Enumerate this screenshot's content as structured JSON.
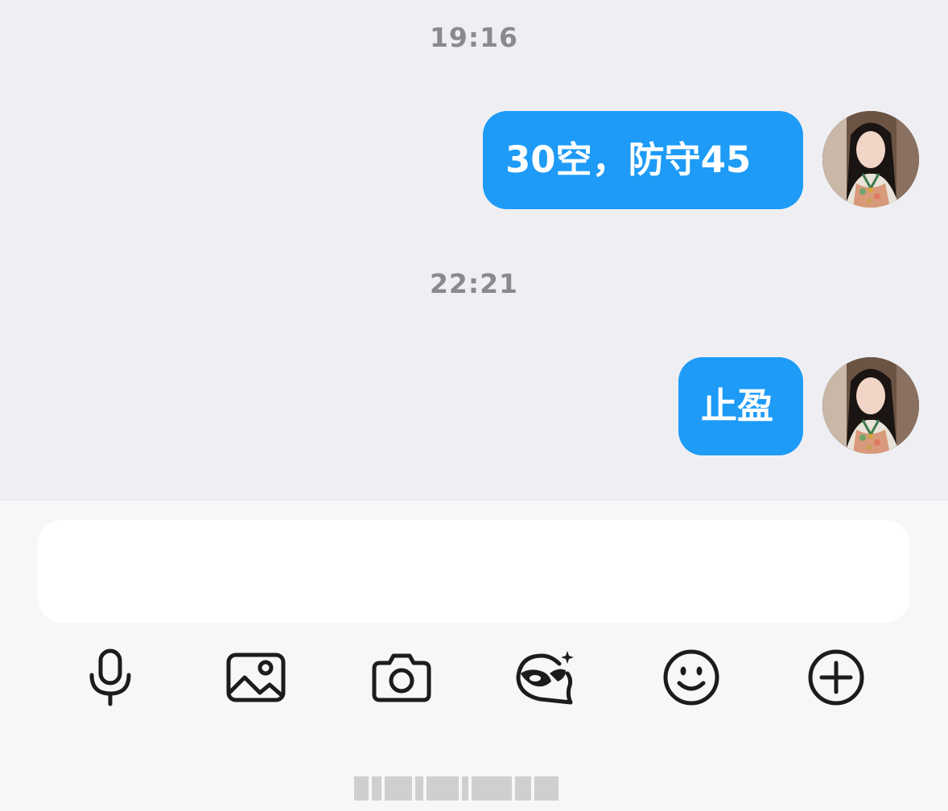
{
  "conversation": {
    "messages": [
      {
        "timestamp": "19:16",
        "text": "30空，防守45",
        "sender": "self"
      },
      {
        "timestamp": "22:21",
        "text": "止盈",
        "sender": "self"
      }
    ]
  },
  "composer": {
    "input_value": "",
    "toolbar": [
      {
        "name": "voice",
        "icon": "microphone-icon"
      },
      {
        "name": "photo",
        "icon": "image-icon"
      },
      {
        "name": "camera",
        "icon": "camera-icon"
      },
      {
        "name": "ai-assistant",
        "icon": "ai-sparkle-chat-icon"
      },
      {
        "name": "emoji",
        "icon": "smiley-icon"
      },
      {
        "name": "more",
        "icon": "plus-circle-icon"
      }
    ]
  },
  "colors": {
    "bubble": "#1d9bf7",
    "chat_background": "#efeff3",
    "composer_background": "#f7f7f8",
    "timestamp": "#8a8a8e"
  }
}
